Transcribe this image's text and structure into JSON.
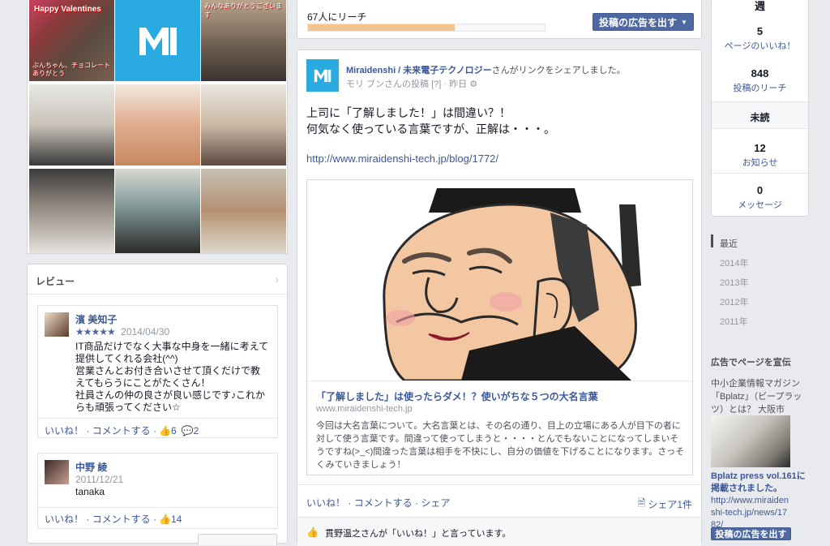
{
  "photos": [
    {
      "label": "Happy Valentines",
      "caption": "ぶんちゃん、チョコレートありがとう",
      "color": "#6b4a3a"
    },
    {
      "label": "M1",
      "color": "#29abe2"
    },
    {
      "label": "みんなありがとうございます",
      "color": "#8a7560"
    },
    {
      "color": "#5d5a52"
    },
    {
      "color": "#d9b3a0"
    },
    {
      "color": "#b8a58f"
    },
    {
      "color": "#706b62"
    },
    {
      "color": "#7a8c8e"
    },
    {
      "color": "#a28570"
    }
  ],
  "reviews": {
    "header": "レビュー",
    "items": [
      {
        "name": "濱 美知子",
        "stars": "★★★★★",
        "date": "2014/04/30",
        "text": "IT商品だけでなく大事な中身を一緒に考えて提供してくれる会社(^^)\n営業さんとお付き合いさせて頂くだけで教えてもらうにことがたくさん！\n社員さんの仲の良さが良い感じです♪これからも頑張ってください☆",
        "actions": "いいね！ · コメントする ·",
        "likes": "6",
        "comments": "2"
      },
      {
        "name": "中野 綾",
        "date": "2011/12/21",
        "text": "tanaka",
        "actions": "いいね！ · コメントする ·",
        "likes": "14"
      }
    ]
  },
  "reach": {
    "text": "67人にリーチ",
    "progress": 0.62,
    "button": "投稿の広告を出す"
  },
  "post": {
    "avatar": "M1",
    "page_name": "Miraidenshi / 未来電子テクノロジー",
    "action_text": "さんがリンクをシェアしました。",
    "posted_by": "モリ ブンさんの投稿",
    "post_meta": " [?] · 昨日 ",
    "body_line1": "上司に「了解しました！」は間違い？！",
    "body_line2": "何気なく使っている言葉ですが、正解は・・・。",
    "url": "http://www.miraidenshi-tech.jp/blog/1772/",
    "link_title": "「了解しました」は使ったらダメ！？使いがちな５つの大名言葉",
    "link_domain": "www.miraidenshi-tech.jp",
    "link_desc": "今回は大名言葉について。大名言葉とは、その名の通り、目上の立場にある人が目下の者に対して使う言葉です。間違って使ってしまうと・・・・とんでもないことになってしまいそうですね(>_<)間違った言葉は相手を不快にし、自分の価値を下げることになります。さっそくみていきましょう！",
    "actions": "いいね！ · コメントする · シェア",
    "share_count": "シェア1件",
    "likes_text": "貫野温之さんが「いいね！」と言っています。"
  },
  "stats": {
    "top_label": "週",
    "likes_n": "5",
    "likes_l": "ページのいいね！",
    "reach_n": "848",
    "reach_l": "投稿のリーチ",
    "unread": "未読",
    "notif_n": "12",
    "notif_l": "お知らせ",
    "msg_n": "0",
    "msg_l": "メッセージ"
  },
  "years": [
    "最近",
    "2014年",
    "2013年",
    "2012年",
    "2011年"
  ],
  "ad": {
    "header": "広告でページを宣伝",
    "desc": "中小企業情報マガジン「Bplatz」（ビープラッツ）とは？ 大阪市",
    "title": "Bplatz press vol.161に掲載されました。",
    "url": "http://www.miraidenshi-tech.jp/news/1782/",
    "button": "投稿の広告を出す"
  }
}
